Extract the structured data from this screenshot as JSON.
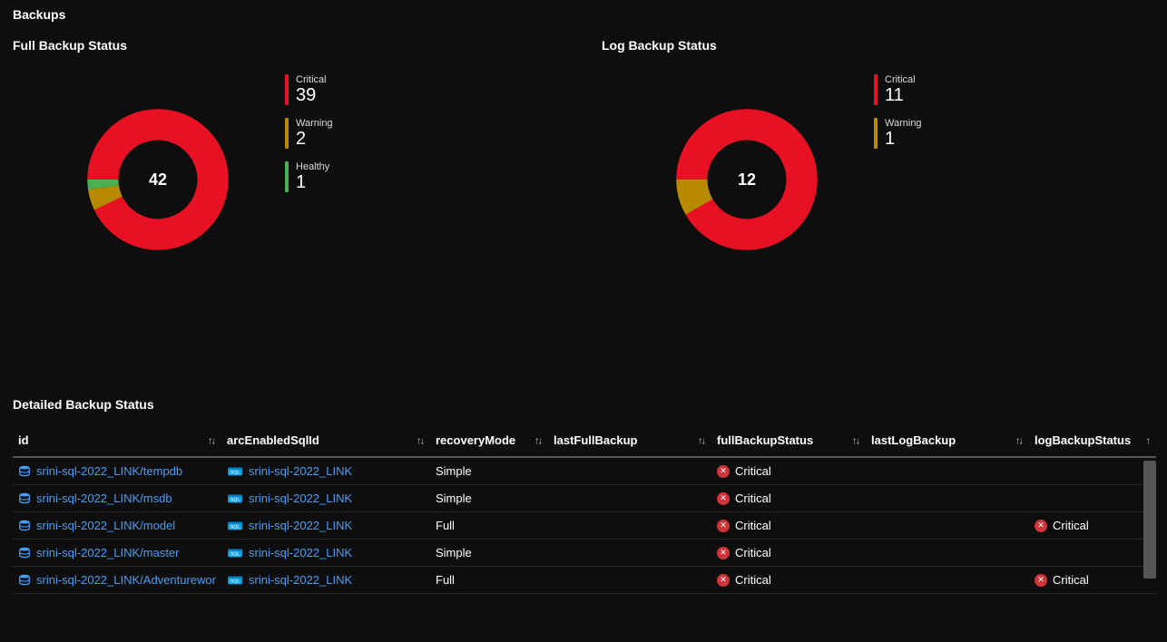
{
  "page_title": "Backups",
  "colors": {
    "critical": "#e81123",
    "warning": "#b88a00",
    "healthy": "#4caf50",
    "link": "#479ef5"
  },
  "charts": {
    "full": {
      "title": "Full Backup Status",
      "total": 42,
      "series": [
        {
          "label": "Critical",
          "value": 39,
          "color": "#e81123"
        },
        {
          "label": "Warning",
          "value": 2,
          "color": "#b88a00"
        },
        {
          "label": "Healthy",
          "value": 1,
          "color": "#4caf50"
        }
      ]
    },
    "log": {
      "title": "Log Backup Status",
      "total": 12,
      "series": [
        {
          "label": "Critical",
          "value": 11,
          "color": "#e81123"
        },
        {
          "label": "Warning",
          "value": 1,
          "color": "#b88a00"
        }
      ]
    }
  },
  "chart_data": [
    {
      "type": "pie",
      "title": "Full Backup Status",
      "categories": [
        "Critical",
        "Warning",
        "Healthy"
      ],
      "values": [
        39,
        2,
        1
      ],
      "total": 42
    },
    {
      "type": "pie",
      "title": "Log Backup Status",
      "categories": [
        "Critical",
        "Warning"
      ],
      "values": [
        11,
        1
      ],
      "total": 12
    }
  ],
  "table": {
    "title": "Detailed Backup Status",
    "columns": {
      "id": "id",
      "arcEnabledSqlId": "arcEnabledSqlId",
      "recoveryMode": "recoveryMode",
      "lastFullBackup": "lastFullBackup",
      "fullBackupStatus": "fullBackupStatus",
      "lastLogBackup": "lastLogBackup",
      "logBackupStatus": "logBackupStatus"
    },
    "rows": [
      {
        "id": "srini-sql-2022_LINK/tempdb",
        "arc": "srini-sql-2022_LINK",
        "recovery": "Simple",
        "lastFull": "",
        "fullStatus": "Critical",
        "lastLog": "",
        "logStatus": ""
      },
      {
        "id": "srini-sql-2022_LINK/msdb",
        "arc": "srini-sql-2022_LINK",
        "recovery": "Simple",
        "lastFull": "",
        "fullStatus": "Critical",
        "lastLog": "",
        "logStatus": ""
      },
      {
        "id": "srini-sql-2022_LINK/model",
        "arc": "srini-sql-2022_LINK",
        "recovery": "Full",
        "lastFull": "",
        "fullStatus": "Critical",
        "lastLog": "",
        "logStatus": "Critical"
      },
      {
        "id": "srini-sql-2022_LINK/master",
        "arc": "srini-sql-2022_LINK",
        "recovery": "Simple",
        "lastFull": "",
        "fullStatus": "Critical",
        "lastLog": "",
        "logStatus": ""
      },
      {
        "id": "srini-sql-2022_LINK/Adventurewor",
        "arc": "srini-sql-2022_LINK",
        "recovery": "Full",
        "lastFull": "",
        "fullStatus": "Critical",
        "lastLog": "",
        "logStatus": "Critical"
      }
    ]
  }
}
